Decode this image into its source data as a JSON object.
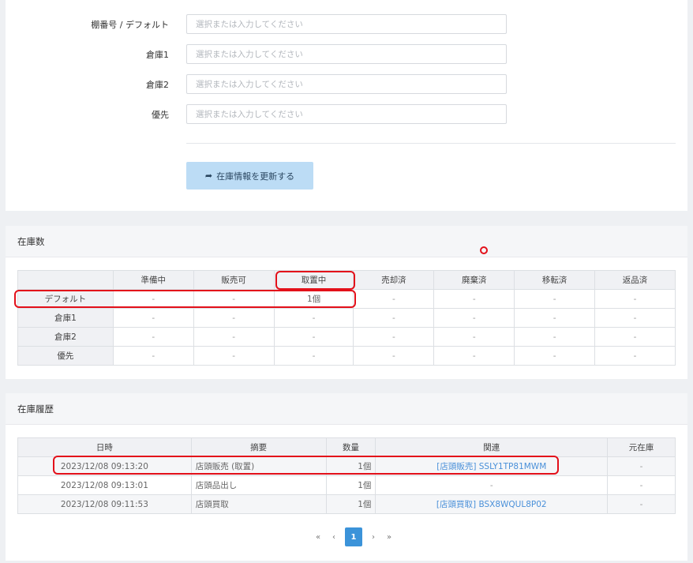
{
  "form": {
    "fields": [
      {
        "label": "棚番号 / デフォルト",
        "placeholder": "選択または入力してください",
        "value": ""
      },
      {
        "label": "倉庫1",
        "placeholder": "選択または入力してください",
        "value": ""
      },
      {
        "label": "倉庫2",
        "placeholder": "選択または入力してください",
        "value": ""
      },
      {
        "label": "優先",
        "placeholder": "選択または入力してください",
        "value": ""
      }
    ],
    "update_button": "在庫情報を更新する"
  },
  "stock": {
    "title": "在庫数",
    "columns": [
      "",
      "準備中",
      "販売可",
      "取置中",
      "売却済",
      "廃棄済",
      "移転済",
      "返品済"
    ],
    "rows": [
      {
        "name": "デフォルト",
        "cells": [
          "-",
          "-",
          "1個",
          "-",
          "-",
          "-",
          "-"
        ]
      },
      {
        "name": "倉庫1",
        "cells": [
          "-",
          "-",
          "-",
          "-",
          "-",
          "-",
          "-"
        ]
      },
      {
        "name": "倉庫2",
        "cells": [
          "-",
          "-",
          "-",
          "-",
          "-",
          "-",
          "-"
        ]
      },
      {
        "name": "優先",
        "cells": [
          "-",
          "-",
          "-",
          "-",
          "-",
          "-",
          "-"
        ]
      }
    ]
  },
  "history": {
    "title": "在庫履歴",
    "columns": [
      "日時",
      "摘要",
      "数量",
      "関連",
      "元在庫"
    ],
    "rows": [
      {
        "datetime": "2023/12/08 09:13:20",
        "summary": "店頭販売 (取置)",
        "qty": "1個",
        "related": "[店頭販売] SSLY1TP81MWM",
        "origin": "-"
      },
      {
        "datetime": "2023/12/08 09:13:01",
        "summary": "店頭品出し",
        "qty": "1個",
        "related": "-",
        "origin": "-"
      },
      {
        "datetime": "2023/12/08 09:11:53",
        "summary": "店頭買取",
        "qty": "1個",
        "related": "[店頭買取] BSX8WQUL8P02",
        "origin": "-"
      }
    ]
  },
  "pagination": {
    "first": "«",
    "prev": "‹",
    "current": "1",
    "next": "›",
    "last": "»"
  },
  "colors": {
    "highlight": "#e3101a",
    "accent": "#3b93d9",
    "button_bg": "#bcdcf5",
    "link": "#4a90d9"
  }
}
